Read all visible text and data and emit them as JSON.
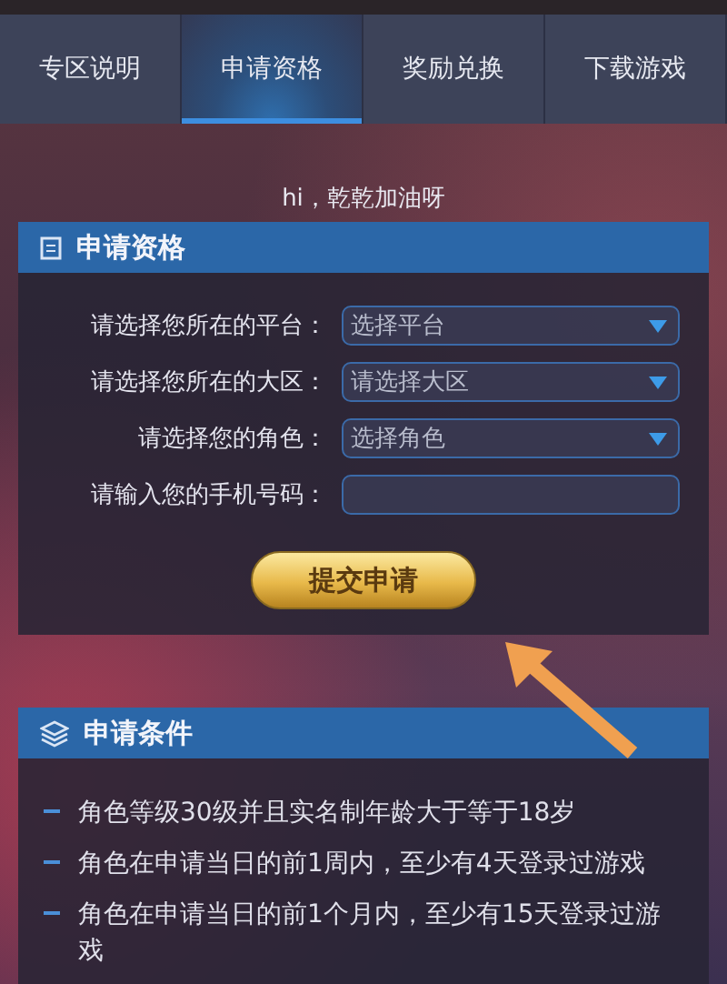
{
  "tabs": [
    {
      "label": "专区说明",
      "selected": false
    },
    {
      "label": "申请资格",
      "selected": true
    },
    {
      "label": "奖励兑换",
      "selected": false
    },
    {
      "label": "下载游戏",
      "selected": false
    }
  ],
  "greeting": "hi，乾乾加油呀",
  "apply_panel": {
    "title": "申请资格",
    "fields": [
      {
        "kind": "select",
        "label": "请选择您所在的平台：",
        "value": "选择平台"
      },
      {
        "kind": "select",
        "label": "请选择您所在的大区：",
        "value": "请选择大区"
      },
      {
        "kind": "select",
        "label": "请选择您的角色：",
        "value": "选择角色"
      },
      {
        "kind": "input",
        "label": "请输入您的手机号码："
      }
    ],
    "submit_button": "提交申请"
  },
  "conditions_panel": {
    "title": "申请条件",
    "items": [
      "角色等级30级并且实名制年龄大于等于18岁",
      "角色在申请当日的前1周内，至少有4天登录过游戏",
      "角色在申请当日的前1个月内，至少有15天登录过游戏"
    ]
  }
}
